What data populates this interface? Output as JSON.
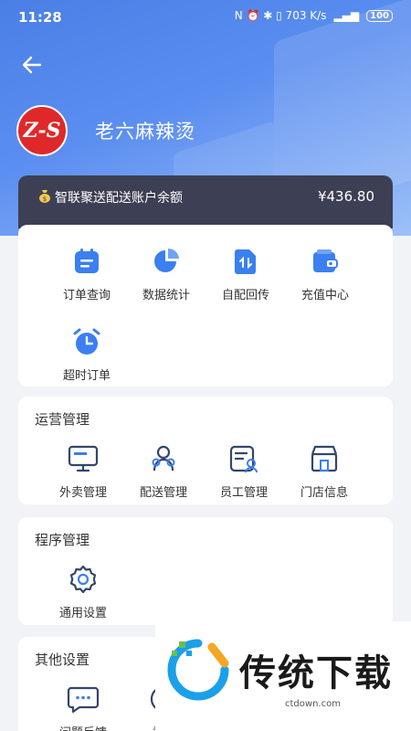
{
  "status_bar": {
    "time": "11:28",
    "indicators": "N  ⏰ ✱ ▯ 703 K/s",
    "signal": "▂▄▆",
    "battery": "100"
  },
  "header": {
    "store_name": "老六麻辣烫",
    "logo_text": "Z-S"
  },
  "balance": {
    "label": "智联聚送配送账户余额",
    "amount": "¥436.80"
  },
  "quick_actions": [
    {
      "label": "订单查询",
      "icon": "order-query-icon"
    },
    {
      "label": "数据统计",
      "icon": "pie-chart-icon"
    },
    {
      "label": "自配回传",
      "icon": "upload-file-icon"
    },
    {
      "label": "充值中心",
      "icon": "wallet-icon"
    },
    {
      "label": "超时订单",
      "icon": "alarm-clock-icon"
    }
  ],
  "operations": {
    "title": "运营管理",
    "items": [
      {
        "label": "外卖管理",
        "icon": "monitor-icon"
      },
      {
        "label": "配送管理",
        "icon": "rider-icon"
      },
      {
        "label": "员工管理",
        "icon": "staff-card-icon"
      },
      {
        "label": "门店信息",
        "icon": "store-icon"
      }
    ]
  },
  "program": {
    "title": "程序管理",
    "items": [
      {
        "label": "通用设置",
        "icon": "gear-icon"
      }
    ]
  },
  "other": {
    "title": "其他设置",
    "items": [
      {
        "label": "问题反馈",
        "icon": "feedback-icon"
      },
      {
        "label": "关于",
        "icon": "about-icon"
      }
    ]
  },
  "watermark": {
    "text": "传统下载",
    "url": "ctdown.com"
  },
  "colors": {
    "accent": "#4a7fe6",
    "icon_blue": "#3b7ff0",
    "outline": "#33466b",
    "balance_bg": "#3d3f54"
  }
}
